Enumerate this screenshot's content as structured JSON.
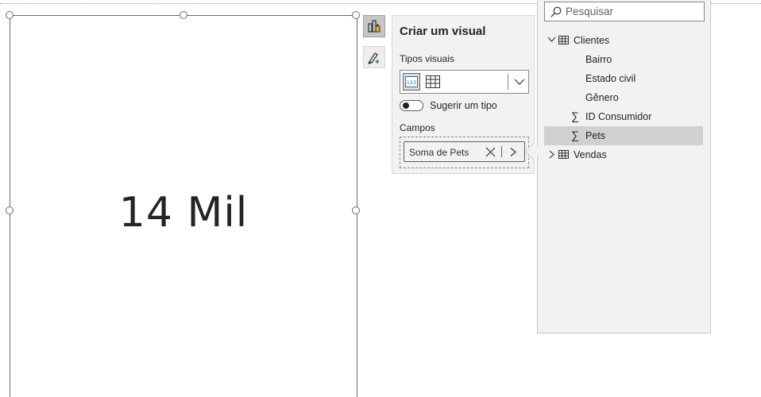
{
  "card": {
    "value": "14 Mil"
  },
  "side_buttons": {
    "build_visual": "build-visual-icon",
    "format": "format-paint-icon"
  },
  "popup": {
    "title": "Criar um visual",
    "visual_types_label": "Tipos visuais",
    "suggest_label": "Sugerir um tipo",
    "fields_label": "Campos",
    "field_pill": "Soma de Pets"
  },
  "fields_pane": {
    "search_placeholder": "Pesquisar",
    "tables": [
      {
        "name": "Clientes",
        "expanded": true,
        "fields": [
          {
            "name": "Bairro",
            "sigma": false
          },
          {
            "name": "Estado civil",
            "sigma": false
          },
          {
            "name": "Gênero",
            "sigma": false
          },
          {
            "name": "ID Consumidor",
            "sigma": true
          },
          {
            "name": "Pets",
            "sigma": true,
            "selected": true
          }
        ]
      },
      {
        "name": "Vendas",
        "expanded": false,
        "fields": []
      }
    ]
  },
  "colors": {
    "selected_row": "#d2d0ce",
    "pane_bg": "#f3f2f1"
  }
}
